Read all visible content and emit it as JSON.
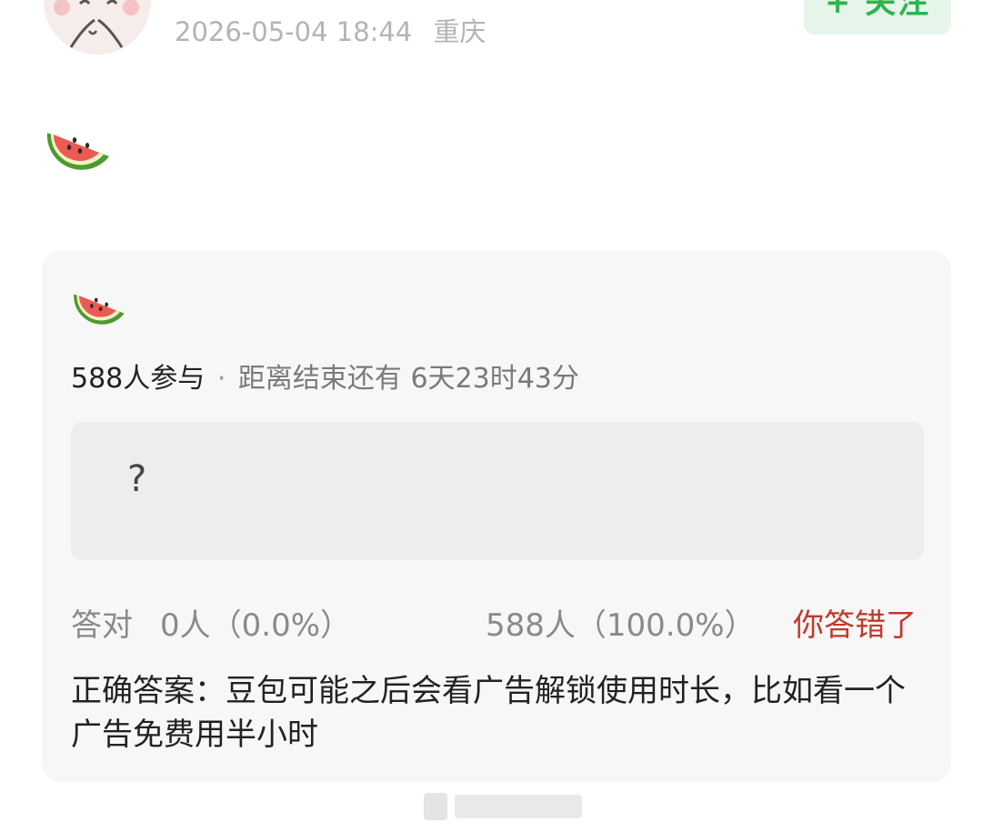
{
  "post": {
    "timestamp": "2026-05-04 18:44",
    "location": "重庆",
    "follow_label": "+ 关注",
    "emoji": "watermelon-icon"
  },
  "quiz": {
    "emoji": "watermelon-icon",
    "participants": "588人参与",
    "separator": "·",
    "countdown": "距离结束还有 6天23时43分",
    "option_text": "?",
    "correct_label": "答对",
    "correct_count": "0人（0.0%）",
    "wrong_count": "588人（100.0%）",
    "wrong_message": "你答错了",
    "answer_text": "正确答案：豆包可能之后会看广告解锁使用时长，比如看一个广告免费用半小时"
  },
  "colors": {
    "follow_green": "#2fb44e",
    "wrong_red": "#c0392b",
    "card_bg": "#f7f7f7"
  }
}
